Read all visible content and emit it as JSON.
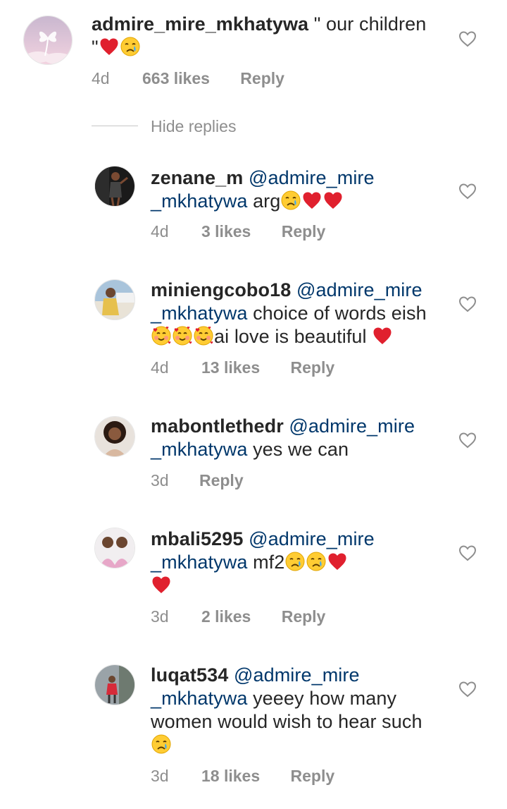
{
  "main_comment": {
    "username": "admire_mire_mkhatywa",
    "text_line1": " \" our children",
    "text_line2": "\"",
    "emojis": [
      "red-heart",
      "crying-face"
    ],
    "time": "4d",
    "likes": "663 likes",
    "reply_label": "Reply"
  },
  "hide_replies_label": "Hide replies",
  "replies": [
    {
      "username": "zenane_m",
      "mention_part1": "@admire_mire",
      "mention_part2": "_mkhatywa",
      "text": " arg",
      "time": "4d",
      "likes": "3 likes",
      "reply_label": "Reply"
    },
    {
      "username": "miniengcobo18",
      "mention_part1": "@admire_mire",
      "mention_part2": "_mkhatywa",
      "text": " choice of words eish",
      "text2": "ai love is beautiful ",
      "time": "4d",
      "likes": "13 likes",
      "reply_label": "Reply"
    },
    {
      "username": "mabontlethedr",
      "mention_part1": "@admire_mire",
      "mention_part2": "_mkhatywa",
      "text": " yes we can",
      "time": "3d",
      "reply_label": "Reply"
    },
    {
      "username": "mbali5295",
      "mention_part1": "@admire_mire",
      "mention_part2": "_mkhatywa",
      "text": " mf2",
      "time": "3d",
      "likes": "2 likes",
      "reply_label": "Reply"
    },
    {
      "username": "luqat534",
      "mention_part1": "@admire_mire",
      "mention_part2": "_mkhatywa",
      "text": " yeeey how many",
      "text2": "women would wish to hear such",
      "time": "3d",
      "likes": "18 likes",
      "reply_label": "Reply"
    }
  ],
  "colors": {
    "text": "#262626",
    "secondary": "#8e8e8e",
    "mention": "#00376b",
    "heart_red": "#e0202e"
  }
}
